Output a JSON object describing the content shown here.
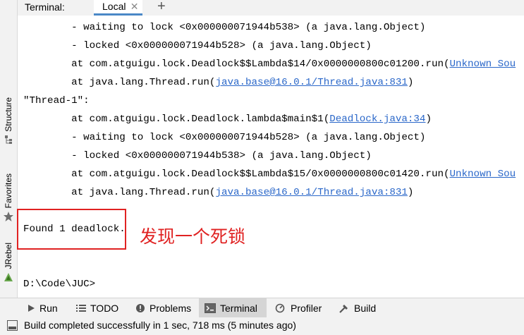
{
  "tabs": {
    "title": "Terminal:",
    "active_tab": "Local",
    "close_glyph": "✕",
    "add_glyph": "+"
  },
  "sidebar": {
    "items": [
      {
        "label": "Structure",
        "icon": "structure-icon"
      },
      {
        "label": "Favorites",
        "icon": "star-icon"
      },
      {
        "label": "JRebel",
        "icon": "jrebel-icon"
      }
    ]
  },
  "console": {
    "lines": [
      {
        "pre": "        - waiting to lock <0x000000071944b538> (a java.lang.Object)",
        "link": "",
        "post": ""
      },
      {
        "pre": "        - locked <0x000000071944b528> (a java.lang.Object)",
        "link": "",
        "post": ""
      },
      {
        "pre": "        at com.atguigu.lock.Deadlock$$Lambda$14/0x0000000800c01200.run(",
        "link": "Unknown Sou",
        "post": ""
      },
      {
        "pre": "        at java.lang.Thread.run(",
        "link": "java.base@16.0.1/Thread.java:831",
        "post": ")"
      },
      {
        "pre": "\"Thread-1\":",
        "link": "",
        "post": ""
      },
      {
        "pre": "        at com.atguigu.lock.Deadlock.lambda$main$1(",
        "link": "Deadlock.java:34",
        "post": ")"
      },
      {
        "pre": "        - waiting to lock <0x000000071944b528> (a java.lang.Object)",
        "link": "",
        "post": ""
      },
      {
        "pre": "        - locked <0x000000071944b538> (a java.lang.Object)",
        "link": "",
        "post": ""
      },
      {
        "pre": "        at com.atguigu.lock.Deadlock$$Lambda$15/0x0000000800c01420.run(",
        "link": "Unknown Sou",
        "post": ""
      },
      {
        "pre": "        at java.lang.Thread.run(",
        "link": "java.base@16.0.1/Thread.java:831",
        "post": ")"
      }
    ],
    "found": "Found 1 deadlock.",
    "prompt": "D:\\Code\\JUC>"
  },
  "annotation": "发现一个死锁",
  "toolbar": {
    "items": [
      {
        "label": "Run",
        "icon": "run-icon"
      },
      {
        "label": "TODO",
        "icon": "todo-icon"
      },
      {
        "label": "Problems",
        "icon": "problems-icon"
      },
      {
        "label": "Terminal",
        "icon": "terminal-icon",
        "active": true
      },
      {
        "label": "Profiler",
        "icon": "profiler-icon"
      },
      {
        "label": "Build",
        "icon": "build-icon"
      }
    ]
  },
  "status": {
    "text": "Build completed successfully in 1 sec, 718 ms (5 minutes ago)"
  },
  "colors": {
    "link": "#2a67c9",
    "annotation": "#e02222",
    "accent": "#4a88c7"
  }
}
